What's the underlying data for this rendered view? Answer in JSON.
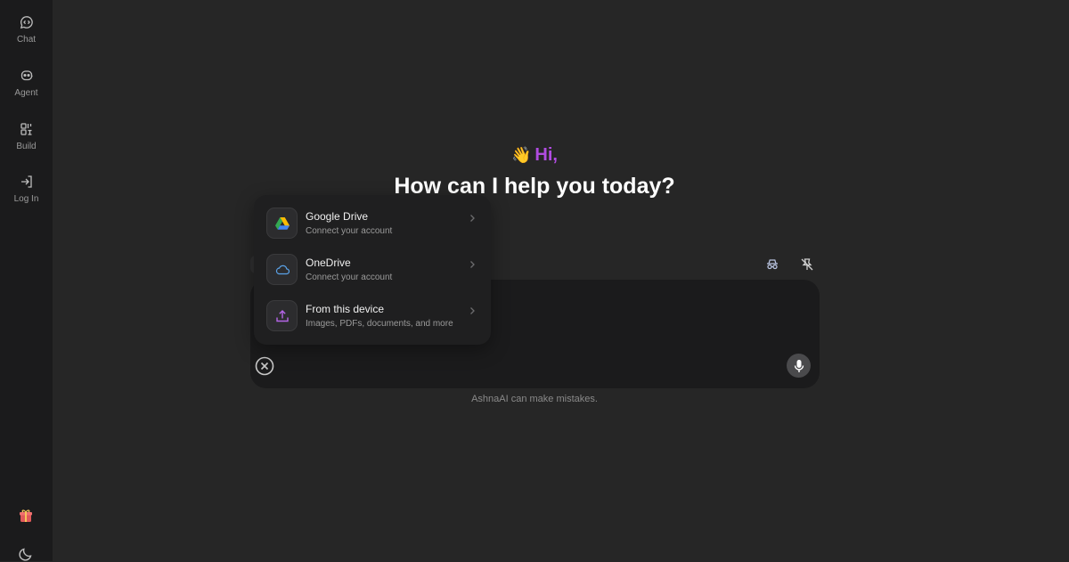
{
  "sidebar": {
    "items": [
      {
        "label": "Chat",
        "icon": "chat-icon"
      },
      {
        "label": "Agent",
        "icon": "agent-icon"
      },
      {
        "label": "Build",
        "icon": "build-icon"
      },
      {
        "label": "Log In",
        "icon": "login-icon"
      }
    ],
    "bottom_icons": [
      "gift-icon",
      "moon-icon"
    ]
  },
  "greeting": {
    "emoji": "👋",
    "hi": "Hi,",
    "headline": "How can I help you today?"
  },
  "attach_menu": {
    "items": [
      {
        "title": "Google Drive",
        "subtitle": "Connect your account",
        "icon": "google-drive-icon"
      },
      {
        "title": "OneDrive",
        "subtitle": "Connect your account",
        "icon": "onedrive-icon"
      },
      {
        "title": "From this device",
        "subtitle": "Images, PDFs, documents, and more",
        "icon": "upload-icon"
      }
    ]
  },
  "composer": {
    "close_icon": "close-circle-icon",
    "mic_icon": "microphone-icon"
  },
  "toolbar": {
    "icons": [
      "incognito-icon",
      "unpin-icon"
    ]
  },
  "disclaimer": "AshnaAI can make mistakes.",
  "colors": {
    "accent": "#b04ce0",
    "background": "#262626",
    "sidebar": "#1b1b1c"
  }
}
